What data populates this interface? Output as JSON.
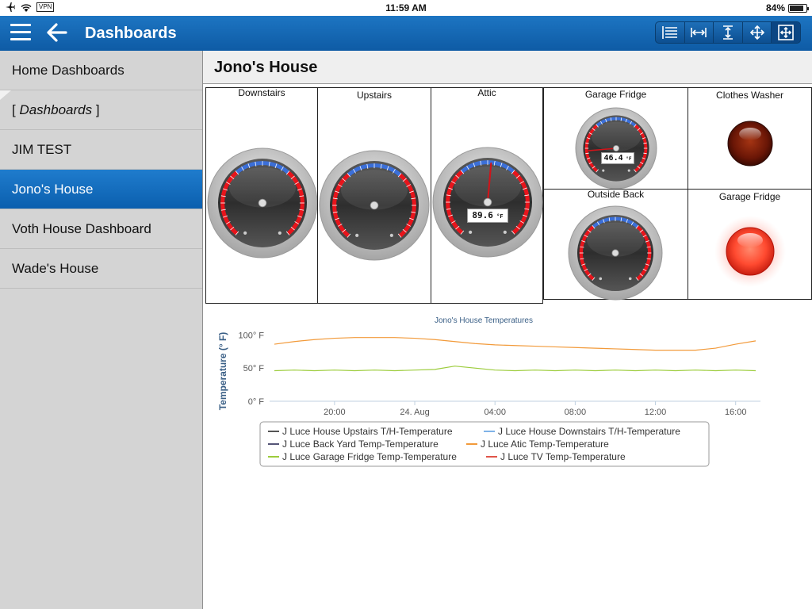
{
  "status_bar": {
    "vpn_label": "VPN",
    "time": "11:59 AM",
    "battery": "84%"
  },
  "nav": {
    "title": "Dashboards"
  },
  "sidebar": {
    "items": [
      {
        "label": "Home Dashboards"
      },
      {
        "label": "Dashboards"
      },
      {
        "label": "JIM TEST"
      },
      {
        "label": "Jono's House"
      },
      {
        "label": "Voth House Dashboard"
      },
      {
        "label": "Wade's House"
      }
    ]
  },
  "main": {
    "title": "Jono's House",
    "panels": {
      "downstairs": "Downstairs",
      "upstairs": "Upstairs",
      "attic": "Attic",
      "attic_readout": "89.6",
      "garage_fridge": "Garage Fridge",
      "garage_fridge_readout": "46.4",
      "outside_back": "Outside Back",
      "clothes_washer": "Clothes Washer",
      "garage_fridge_light": "Garage Fridge"
    }
  },
  "colors": {
    "nav_blue": "#1266b4",
    "gauge_red": "#e8141b",
    "gauge_blue": "#3b6fd8",
    "series_orange": "#f29a3a",
    "series_green": "#9ccc3c"
  },
  "chart_data": {
    "type": "line",
    "title": "Jono's House Temperatures",
    "ylabel": "Temperature (° F)",
    "ylim": [
      0,
      110
    ],
    "y_ticks": [
      "0° F",
      "50° F",
      "100° F"
    ],
    "x_ticks": [
      "20:00",
      "24. Aug",
      "04:00",
      "08:00",
      "12:00",
      "16:00"
    ],
    "x_hours": [
      17,
      18,
      19,
      20,
      21,
      22,
      23,
      24,
      25,
      26,
      27,
      28,
      29,
      30,
      31,
      32,
      33,
      34,
      35,
      36,
      37,
      38,
      39,
      40,
      41
    ],
    "series": [
      {
        "name": "J Luce House Upstairs T/H-Temperature",
        "color": "#555555",
        "values": []
      },
      {
        "name": "J Luce House Downstairs T/H-Temperature",
        "color": "#7fb3e8",
        "values": []
      },
      {
        "name": "J Luce Back Yard Temp-Temperature",
        "color": "#555577",
        "values": []
      },
      {
        "name": "J Luce Atic Temp-Temperature",
        "color": "#f29a3a",
        "values": [
          86,
          90,
          93,
          95,
          96,
          96,
          96,
          95,
          93,
          90,
          87,
          85,
          84,
          83,
          82,
          81,
          80,
          79,
          78,
          77,
          77,
          77,
          80,
          86,
          91
        ]
      },
      {
        "name": "J Luce Garage Fridge Temp-Temperature",
        "color": "#9ccc3c",
        "values": [
          46,
          47,
          46,
          47,
          46,
          47,
          46,
          47,
          48,
          53,
          50,
          47,
          46,
          47,
          46,
          47,
          46,
          47,
          46,
          47,
          46,
          47,
          46,
          47,
          46
        ]
      },
      {
        "name": "J Luce TV Temp-Temperature",
        "color": "#e0554a",
        "values": []
      }
    ],
    "legend_position": "bottom"
  }
}
